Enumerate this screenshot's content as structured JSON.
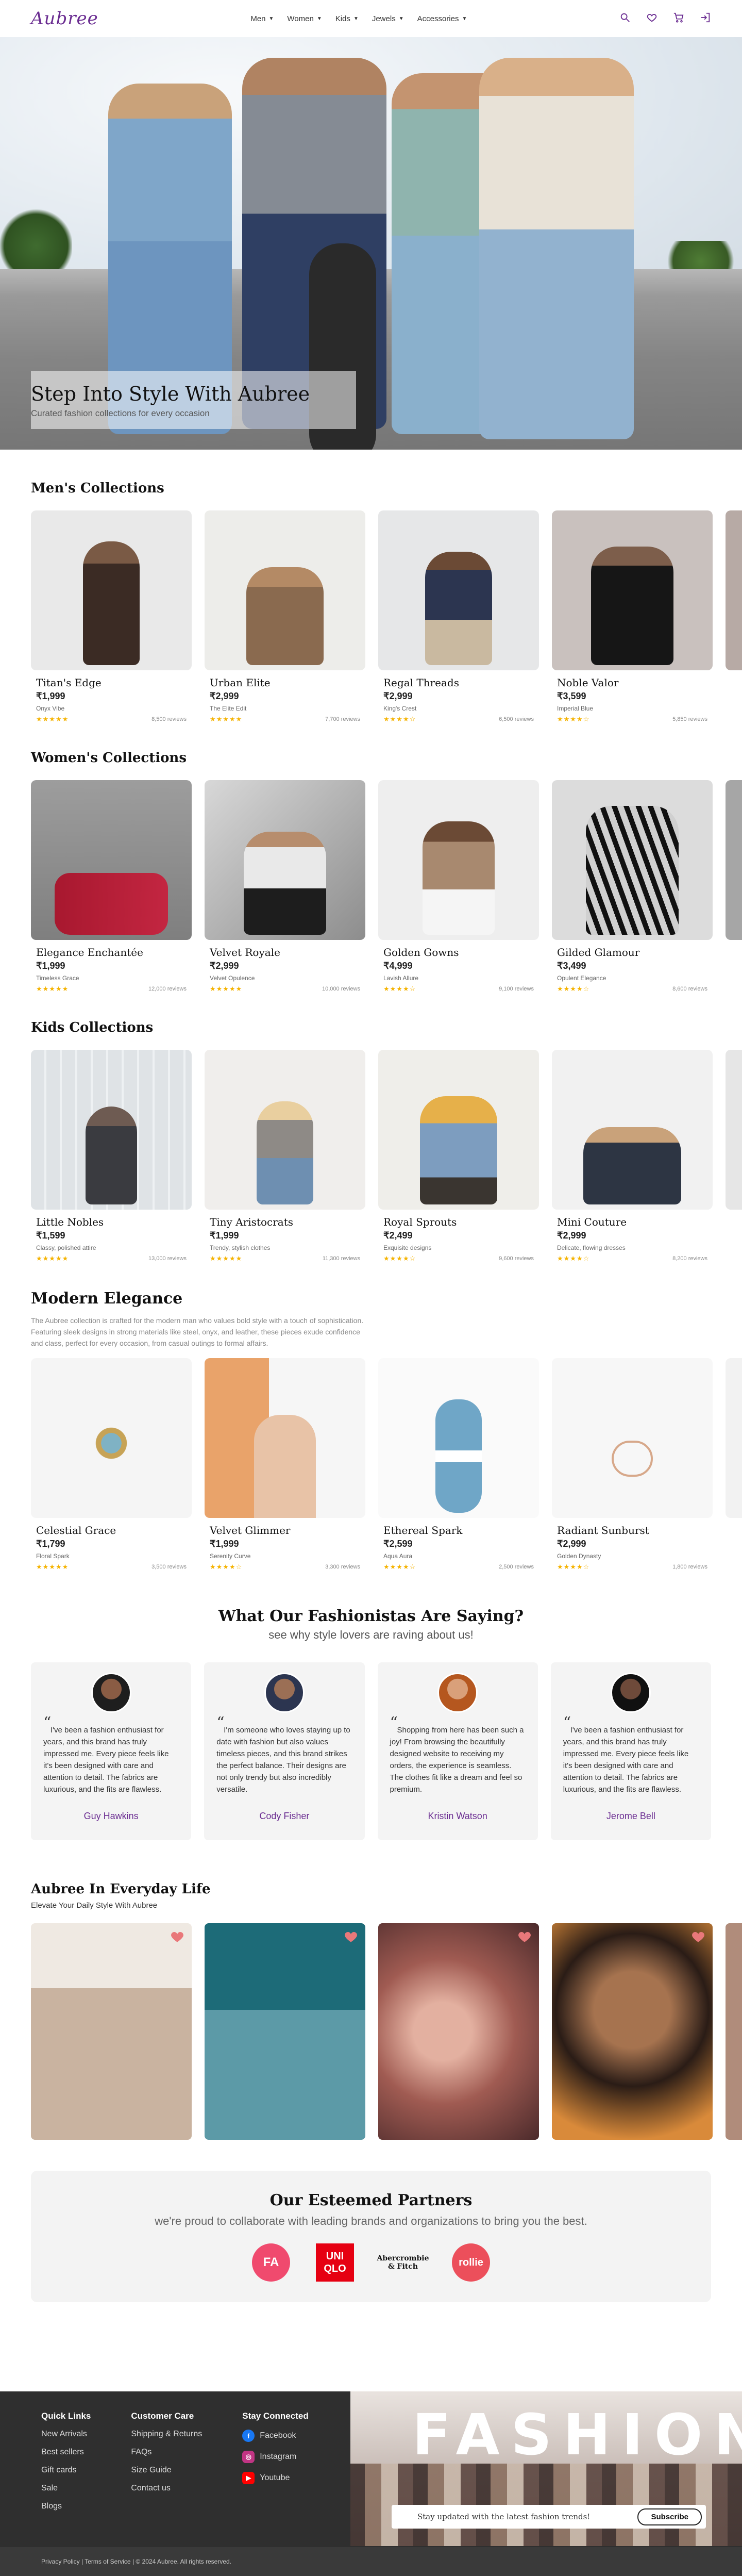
{
  "nav": {
    "logo": "Aubree",
    "menu": [
      "Men",
      "Women",
      "Kids",
      "Jewels",
      "Accessories"
    ],
    "icons": [
      "search-icon",
      "heart-icon",
      "cart-icon",
      "login-icon"
    ]
  },
  "hero": {
    "title": "Step Into Style With Aubree",
    "subtitle": "Curated fashion collections for every occasion"
  },
  "men": {
    "title": "Men's Collections",
    "items": [
      {
        "name": "Titan's Edge",
        "price": "₹1,999",
        "brand": "Onyx Vibe",
        "stars": "★★★★★",
        "reviews": "8,500 reviews"
      },
      {
        "name": "Urban Elite",
        "price": "₹2,999",
        "brand": "The Elite Edit",
        "stars": "★★★★★",
        "reviews": "7,700 reviews"
      },
      {
        "name": "Regal Threads",
        "price": "₹2,999",
        "brand": "King's Crest",
        "stars": "★★★★☆",
        "reviews": "6,500 reviews"
      },
      {
        "name": "Noble Valor",
        "price": "₹3,599",
        "brand": "Imperial Blue",
        "stars": "★★★★☆",
        "reviews": "5,850 reviews"
      }
    ]
  },
  "women": {
    "title": "Women's Collections",
    "items": [
      {
        "name": "Elegance Enchantée",
        "price": "₹1,999",
        "brand": "Timeless Grace",
        "stars": "★★★★★",
        "reviews": "12,000 reviews"
      },
      {
        "name": "Velvet Royale",
        "price": "₹2,999",
        "brand": "Velvet Opulence",
        "stars": "★★★★★",
        "reviews": "10,000 reviews"
      },
      {
        "name": "Golden Gowns",
        "price": "₹4,999",
        "brand": "Lavish Allure",
        "stars": "★★★★☆",
        "reviews": "9,100 reviews"
      },
      {
        "name": "Gilded Glamour",
        "price": "₹3,499",
        "brand": "Opulent Elegance",
        "stars": "★★★★☆",
        "reviews": "8,600 reviews"
      }
    ]
  },
  "kids": {
    "title": "Kids Collections",
    "items": [
      {
        "name": "Little Nobles",
        "price": "₹1,599",
        "brand": "Classy, polished attire",
        "stars": "★★★★★",
        "reviews": "13,000 reviews"
      },
      {
        "name": "Tiny Aristocrats",
        "price": "₹1,999",
        "brand": "Trendy, stylish clothes",
        "stars": "★★★★★",
        "reviews": "11,300 reviews"
      },
      {
        "name": "Royal Sprouts",
        "price": "₹2,499",
        "brand": "Exquisite designs",
        "stars": "★★★★☆",
        "reviews": "9,600 reviews"
      },
      {
        "name": "Mini Couture",
        "price": "₹2,999",
        "brand": "Delicate, flowing dresses",
        "stars": "★★★★☆",
        "reviews": "8,200 reviews"
      }
    ]
  },
  "elegance": {
    "title": "Modern Elegance",
    "description": "The Aubree collection is crafted for the modern man who values bold style with a touch of sophistication. Featuring sleek designs in strong materials like steel, onyx, and leather, these pieces exude confidence and class, perfect for every occasion, from casual outings to formal affairs.",
    "items": [
      {
        "name": "Celestial Grace",
        "price": "₹1,799",
        "brand": "Floral Spark",
        "stars": "★★★★★",
        "reviews": "3,500 reviews"
      },
      {
        "name": "Velvet Glimmer",
        "price": "₹1,999",
        "brand": "Serenity Curve",
        "stars": "★★★★☆",
        "reviews": "3,300 reviews"
      },
      {
        "name": "Ethereal Spark",
        "price": "₹2,599",
        "brand": "Aqua Aura",
        "stars": "★★★★☆",
        "reviews": "2,500 reviews"
      },
      {
        "name": "Radiant Sunburst",
        "price": "₹2,999",
        "brand": "Golden Dynasty",
        "stars": "★★★★☆",
        "reviews": "1,800 reviews"
      }
    ]
  },
  "testimonials": {
    "title": "What Our Fashionistas Are Saying?",
    "subtitle": "see why style lovers are raving about us!",
    "items": [
      {
        "text": "I've been a fashion enthusiast for years, and this brand has truly impressed me. Every piece feels like it's been designed with care and attention to detail. The fabrics are luxurious, and the fits are flawless.",
        "name": "Guy Hawkins"
      },
      {
        "text": "I'm someone who loves staying up to date with fashion but also values timeless pieces, and this brand strikes the perfect balance. Their designs are not only trendy but also incredibly versatile.",
        "name": "Cody Fisher"
      },
      {
        "text": "Shopping from here has been such a joy! From browsing the beautifully designed website to receiving my orders, the experience is seamless. The clothes fit like a dream and feel so premium.",
        "name": "Kristin Watson"
      },
      {
        "text": "I've been a fashion enthusiast for years, and this brand has truly impressed me. Every piece feels like it's been designed with care and attention to detail. The fabrics are luxurious, and the fits are flawless.",
        "name": "Jerome Bell"
      }
    ]
  },
  "everyday": {
    "title": "Aubree In Everyday Life",
    "subtitle": "Elevate Your Daily Style With Aubree"
  },
  "partners": {
    "title": "Our Esteemed Partners",
    "subtitle": "we're proud to collaborate with leading brands and organizations to bring you the best.",
    "logos": [
      {
        "text": "FA"
      },
      {
        "text": "UNI QLO"
      },
      {
        "text": "Abercrombie & Fitch"
      },
      {
        "text": "rollie"
      }
    ]
  },
  "footer": {
    "quick_links": {
      "title": "Quick Links",
      "items": [
        "New Arrivals",
        "Best sellers",
        "Gift cards",
        "Sale",
        "Blogs"
      ]
    },
    "customer_care": {
      "title": "Customer Care",
      "items": [
        "Shipping & Returns",
        "FAQs",
        "Size Guide",
        "Contact us"
      ]
    },
    "stay_connected": {
      "title": "Stay Connected",
      "items": [
        "Facebook",
        "Instagram",
        "Youtube"
      ]
    },
    "banner_sign": "FASHION",
    "subscribe_text": "Stay updated with the latest fashion trends!",
    "subscribe_button": "Subscribe",
    "bottom": "Privacy Policy | Terms of Service | © 2024 Aubree. All rights reserved."
  },
  "colors": {
    "accent": "#6a2c91",
    "stars": "#f5b301",
    "footer": "#2f2f2f"
  }
}
